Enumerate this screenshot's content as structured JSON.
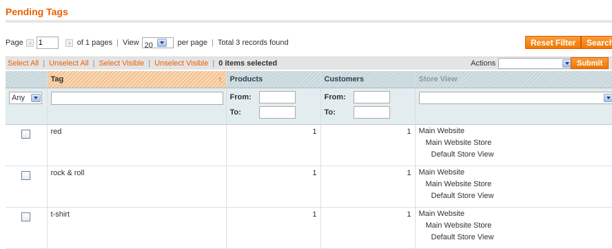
{
  "page": {
    "title": "Pending Tags"
  },
  "pager": {
    "page_label": "Page",
    "page_value": "1",
    "of_pages": "of 1 pages",
    "view_label": "View",
    "per_page_value": "20",
    "per_page_label": "per page",
    "total": "Total 3 records found"
  },
  "buttons": {
    "reset_filter": "Reset Filter",
    "search": "Search",
    "submit": "Submit"
  },
  "massaction": {
    "select_all": "Select All",
    "unselect_all": "Unselect All",
    "select_visible": "Select Visible",
    "unselect_visible": "Unselect Visible",
    "items_selected": "0 items selected",
    "actions_label": "Actions",
    "actions_value": ""
  },
  "grid": {
    "columns": [
      "Tag",
      "Products",
      "Customers",
      "Store View"
    ],
    "filter": {
      "any": "Any",
      "from": "From:",
      "to": "To:"
    },
    "rows": [
      {
        "tag": "red",
        "products": "1",
        "customers": "1",
        "store": [
          "Main Website",
          "Main Website Store",
          "Default Store View"
        ]
      },
      {
        "tag": "rock & roll",
        "products": "1",
        "customers": "1",
        "store": [
          "Main Website",
          "Main Website Store",
          "Default Store View"
        ]
      },
      {
        "tag": "t-shirt",
        "products": "1",
        "customers": "1",
        "store": [
          "Main Website",
          "Main Website Store",
          "Default Store View"
        ]
      }
    ]
  },
  "colors": {
    "accent": "#eb5e00",
    "button": "#f18200",
    "header_bg": "#c7d7dd",
    "filter_bg": "#e3ecef"
  }
}
